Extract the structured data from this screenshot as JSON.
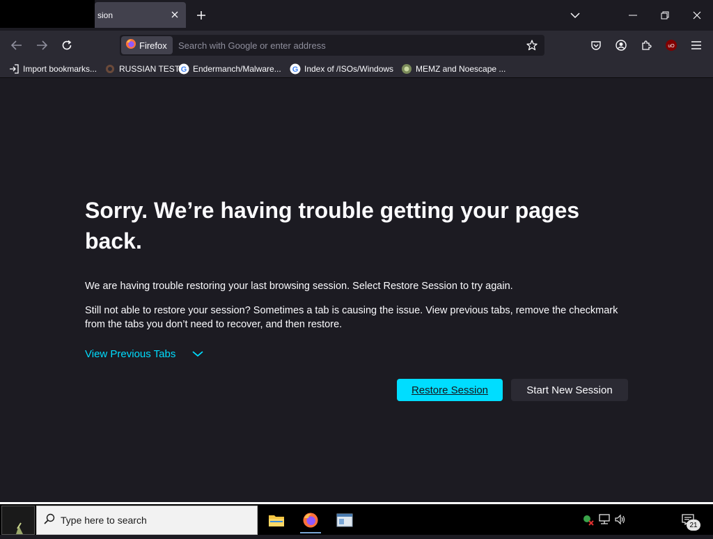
{
  "window": {
    "active_tab_title": "sion"
  },
  "navbar": {
    "identity_label": "Firefox",
    "url_placeholder": "Search with Google or enter address"
  },
  "bookmarks": [
    {
      "label": "Import bookmarks...",
      "icon": "import-icon"
    },
    {
      "label": "RUSSIAN TEST",
      "icon": "site-favicon"
    },
    {
      "label": "Endermanch/Malware...",
      "icon": "google-icon"
    },
    {
      "label": "Index of /ISOs/Windows",
      "icon": "google-icon"
    },
    {
      "label": "MEMZ and Noescape ...",
      "icon": "site-favicon"
    }
  ],
  "content": {
    "title": "Sorry. We’re having trouble getting your pages back.",
    "paragraph1": "We are having trouble restoring your last browsing session. Select Restore Session to try again.",
    "paragraph2": "Still not able to restore your session? Sometimes a tab is causing the issue. View previous tabs, remove the checkmark from the tabs you don’t need to recover, and then restore.",
    "view_previous_tabs": "View Previous Tabs",
    "restore_button": "Restore Session",
    "new_session_button": "Start New Session"
  },
  "taskbar": {
    "search_placeholder": "Type here to search",
    "notification_count": "21"
  },
  "colors": {
    "accent": "#00ddff",
    "page_bg": "#1c1b22",
    "toolbar_bg": "#2b2a33"
  }
}
